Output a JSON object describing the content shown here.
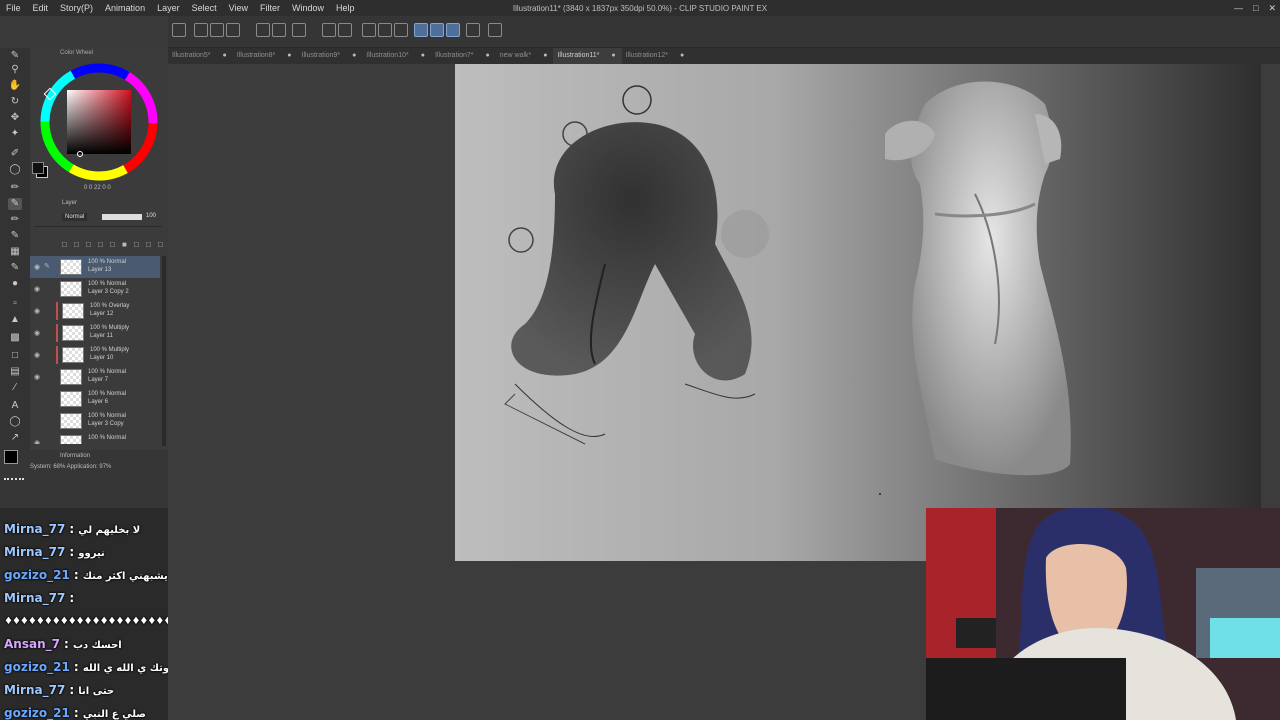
{
  "window": {
    "title": "Illustration11* (3840 x 1837px 350dpi 50.0%) - CLIP STUDIO PAINT EX"
  },
  "menu": {
    "items": [
      "File",
      "Edit",
      "Story(P)",
      "Animation",
      "Layer",
      "Select",
      "View",
      "Filter",
      "Window",
      "Help"
    ]
  },
  "tabs": [
    {
      "label": "Illustration5*"
    },
    {
      "label": "Illustration8*"
    },
    {
      "label": "Illustration9*"
    },
    {
      "label": "Illustration10*"
    },
    {
      "label": "Illustration7*"
    },
    {
      "label": "new walk*"
    },
    {
      "label": "Illustration11*",
      "active": true
    },
    {
      "label": "Illustration12*"
    }
  ],
  "color_panel": {
    "title": "Color Wheel",
    "readout": "0  0  22  0  0"
  },
  "layer_panel": {
    "title": "Layer",
    "blend_mode": "Normal",
    "opacity": "100",
    "layers": [
      {
        "mode": "100 % Normal",
        "name": "Layer 13",
        "selected": true
      },
      {
        "mode": "100 % Normal",
        "name": "Layer 3 Copy 2"
      },
      {
        "mode": "100 % Overlay",
        "name": "Layer 12",
        "clip": true
      },
      {
        "mode": "100 % Multiply",
        "name": "Layer 11",
        "clip": true
      },
      {
        "mode": "100 % Multiply",
        "name": "Layer 10",
        "clip": true
      },
      {
        "mode": "100 % Normal",
        "name": "Layer 7"
      },
      {
        "mode": "100 % Normal",
        "name": "Layer 6"
      },
      {
        "mode": "100 % Normal",
        "name": "Layer 3 Copy"
      },
      {
        "mode": "100 % Normal",
        "name": ""
      }
    ]
  },
  "info_panel": {
    "title": "Information",
    "text": "System: 68%  Application: 97%"
  },
  "chat": [
    {
      "user": "Mirna_77",
      "user_class": "u-mirna",
      "text": "لا بخليهم لي"
    },
    {
      "user": "Mirna_77",
      "user_class": "u-mirna",
      "text": "نيروو"
    },
    {
      "user": "gozizo_21",
      "user_class": "u-gozizo",
      "text": "لو شديت حيلي نيرو يشبهني اكثر منك"
    },
    {
      "user": "Mirna_77",
      "user_class": "u-mirna",
      "text": ""
    },
    {
      "user": "",
      "user_class": "u-mirna",
      "text": "♦♦♦♦♦♦♦♦♦♦♦♦♦♦♦♦♦♦♦♦♦♦♦♦♦♦♦♦♦♦♦♦♦♦♦♦♦♦♦♦♦♦"
    },
    {
      "user": "Ansan_7",
      "user_class": "u-ansan",
      "text": "احسك دب"
    },
    {
      "user": "gozizo_21",
      "user_class": "u-gozizo",
      "text": "لذي الدرجه قدوتك ي الله ي الله"
    },
    {
      "user": "Mirna_77",
      "user_class": "u-mirna",
      "text": "حتى انا"
    },
    {
      "user": "gozizo_21",
      "user_class": "u-gozizo",
      "text": "صلي ع النبي"
    }
  ]
}
